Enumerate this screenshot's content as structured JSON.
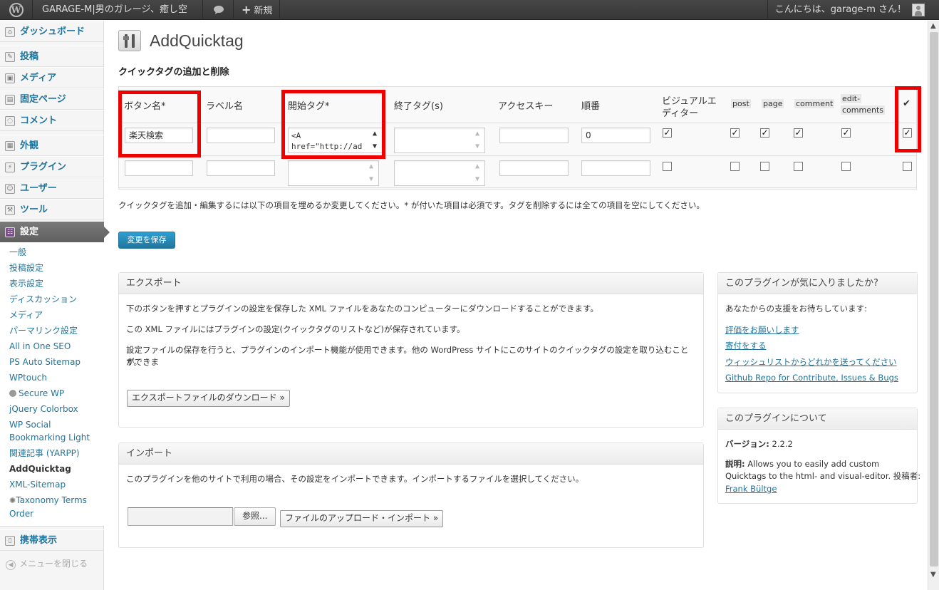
{
  "adminbar": {
    "site_name": "GARAGE-M|男のガレージ、癒し空間",
    "new_label": "新規",
    "greeting": "こんにちは、garage-m さん！"
  },
  "sidebar": {
    "menu": [
      {
        "label": "ダッシュボード",
        "icon": "dashboard-icon"
      },
      {
        "label": "投稿",
        "icon": "pin-icon"
      },
      {
        "label": "メディア",
        "icon": "media-icon"
      },
      {
        "label": "固定ページ",
        "icon": "page-icon"
      },
      {
        "label": "コメント",
        "icon": "comment-icon"
      },
      {
        "label": "外観",
        "icon": "appearance-icon"
      },
      {
        "label": "プラグイン",
        "icon": "plugin-icon"
      },
      {
        "label": "ユーザー",
        "icon": "users-icon"
      },
      {
        "label": "ツール",
        "icon": "tools-icon"
      },
      {
        "label": "設定",
        "icon": "settings-icon"
      },
      {
        "label": "携帯表示",
        "icon": "mobile-icon"
      }
    ],
    "submenu": [
      "一般",
      "投稿設定",
      "表示設定",
      "ディスカッション",
      "メディア",
      "パーマリンク設定",
      "All in One SEO",
      "PS Auto Sitemap",
      "WPtouch",
      "Secure WP",
      "jQuery Colorbox",
      "WP Social Bookmarking Light",
      "関連記事 (YARPP)",
      "AddQuicktag",
      "XML-Sitemap",
      "Taxonomy Terms Order"
    ],
    "collapse_label": "メニューを閉じる"
  },
  "main": {
    "title": "AddQuicktag",
    "section_title": "クイックタグの追加と削除",
    "columns": {
      "button": "ボタン名*",
      "label": "ラベル名",
      "start": "開始タグ*",
      "end": "終了タグ(s)",
      "access": "アクセスキー",
      "order": "順番",
      "visual_1": "ビジュアルエ",
      "visual_2": "ディター",
      "post": "post",
      "page": "page",
      "comment": "comment",
      "edit_1": "edit-",
      "edit_2": "comments",
      "check": "✔"
    },
    "row1": {
      "button": "楽天検索",
      "start_line1": "<A",
      "start_line2": "href=\"http://ad",
      "order": "0"
    },
    "help_text": "クイックタグを追加・編集するには以下の項目を埋めるか変更してください。* が付いた項目は必須です。タグを削除するには全ての項目を空にしてください。",
    "save_label": "変更を保存"
  },
  "export": {
    "title": "エクスポート",
    "p1": "下のボタンを押すとプラグインの設定を保存した XML ファイルをあなたのコンピューターにダウンロードすることができます。",
    "p2": "この XML ファイルにはプラグインの設定(クイックタグのリストなど)が保存されています。",
    "p3a": "設定ファイルの保存を行うと、プラグインのインポート機能が使用できます。他の WordPress サイトにこのサイトのクイックタグの設定を取り込むことができま",
    "p3b": "す。",
    "button": "エクスポートファイルのダウンロード »"
  },
  "import": {
    "title": "インポート",
    "p1": "このプラグインを他のサイトで利用の場合、その設定をインポートできます。インポートするファイルを選択してください。",
    "browse": "参照...",
    "button": "ファイルのアップロード・インポート »"
  },
  "support": {
    "title": "このプラグインが気に入りましたか?",
    "intro": "あなたからの支援をお待ちしています:",
    "links": [
      "評価をお願いします",
      "寄付をする",
      "ウィッシュリストからどれかを送ってください",
      "Github Repo for Contribute, Issues & Bugs"
    ]
  },
  "about": {
    "title": "このプラグインについて",
    "version_label": "バージョン:",
    "version": "2.2.2",
    "desc_label": "説明:",
    "desc_1": "Allows you to easily add custom",
    "desc_2": "Quicktags to the html- and visual-editor. 投稿者:",
    "author": "Frank Bültge"
  },
  "colors": {
    "highlight": "#ee0000",
    "link": "#21759b",
    "button": "#21759b"
  }
}
